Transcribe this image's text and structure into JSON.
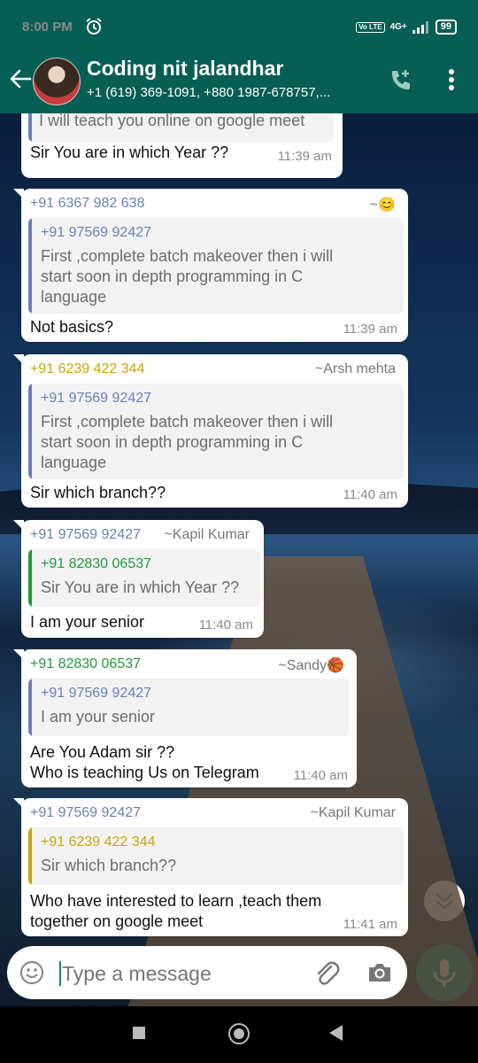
{
  "status_bar": {
    "time": "8:00 PM",
    "network": "4G+",
    "volte": "Vo LTE",
    "battery": "99"
  },
  "header": {
    "title": "Coding nit jalandhar",
    "subtitle": "+1 (619) 369-1091, +880 1987-678757,..."
  },
  "messages": [
    {
      "quote_text_tail": "I will teach you online on google meet",
      "text": "Sir You are in which Year ??",
      "time": "11:39 am"
    },
    {
      "sender": "+91 6367 982 638",
      "alias": "~😊",
      "quote": {
        "sender": "+91 97569 92427",
        "text": "First ,complete batch makeover then i will start soon in depth programming in C language"
      },
      "text": "Not basics?",
      "time": "11:39 am"
    },
    {
      "sender": "+91 6239 422 344",
      "alias": "~Arsh mehta",
      "quote": {
        "sender": "+91 97569 92427",
        "text": "First ,complete batch makeover then i will start soon in depth programming in C language"
      },
      "text": "Sir which branch??",
      "time": "11:40 am"
    },
    {
      "sender": "+91 97569 92427",
      "alias": "~Kapil Kumar",
      "quote": {
        "sender": "+91 82830 06537",
        "text": "Sir You are in which Year ??"
      },
      "text": "I am your senior",
      "time": "11:40 am"
    },
    {
      "sender": "+91 82830 06537",
      "alias": "~Sandy🏀",
      "quote": {
        "sender": "+91 97569 92427",
        "text": "I am your senior"
      },
      "text_line1": "Are You Adam sir ??",
      "text_line2": "Who is teaching Us on Telegram",
      "time": "11:40 am"
    },
    {
      "sender": "+91 97569 92427",
      "alias": "~Kapil Kumar",
      "quote": {
        "sender": "+91 6239 422 344",
        "text": "Sir which branch??"
      },
      "text_line1": "Who have interested to learn ,teach them",
      "text_line2": "together on google meet",
      "time": "11:41 am"
    }
  ],
  "input": {
    "placeholder": "Type a message"
  },
  "colors": {
    "header": "#075e54",
    "sender_blue": "#6a7fb5",
    "sender_yellow": "#c9a50b",
    "sender_green": "#1f9b3a",
    "mic": "#00897b"
  }
}
